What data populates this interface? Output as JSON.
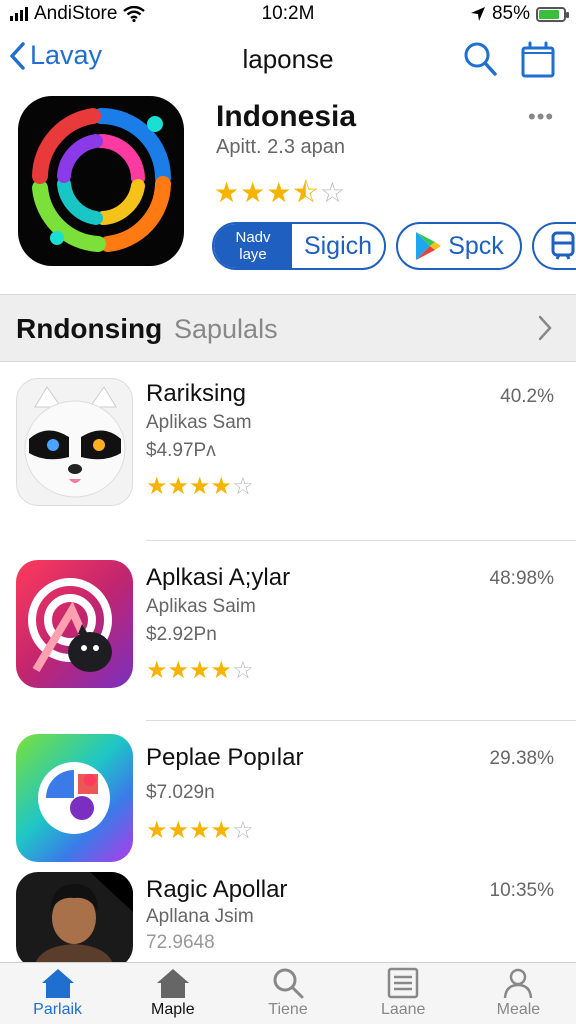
{
  "status_bar": {
    "carrier": "AndiStore",
    "time": "10:2M",
    "battery": "85%",
    "battery_level": 0.85
  },
  "nav": {
    "back_label": "Lavay",
    "title": "laponse"
  },
  "app": {
    "name": "Indonesia",
    "subtitle": "Apitt. 2.3 apan",
    "rating_stars": 3.5,
    "more": "•••",
    "button_seg_line1": "Nadv",
    "button_seg_line2": "laye",
    "button_seg_label": "Sigich",
    "button_play_label": "Spck"
  },
  "section": {
    "title": "Rndonsing",
    "subtitle": "Sapulals"
  },
  "list": [
    {
      "name": "Rariksing",
      "sub": "Aplikas Sam",
      "price": "$4.97Pʌ",
      "pct": "40.2%",
      "stars": 4
    },
    {
      "name": "Aplkasi A;ylar",
      "sub": "Aplikas Saim",
      "price": "$2.92Pn",
      "pct": "48:98%",
      "stars": 4
    },
    {
      "name": "Peplae Popılar",
      "sub": "",
      "price": "$7.029n",
      "pct": "29.38%",
      "stars": 4
    },
    {
      "name": "Ragic Apollar",
      "sub": "Apllana Jsim",
      "price": "72.9648",
      "pct": "10:35%",
      "stars": 0
    }
  ],
  "tabs": [
    {
      "label": "Parlaik",
      "icon": "house-icon"
    },
    {
      "label": "Maple",
      "icon": "house-icon"
    },
    {
      "label": "Tiene",
      "icon": "search-icon"
    },
    {
      "label": "Laane",
      "icon": "list-icon"
    },
    {
      "label": "Meale",
      "icon": "person-icon"
    }
  ],
  "colors": {
    "accent": "#1e6fd0",
    "star": "#f5b400",
    "battery": "#3bbf3b"
  }
}
